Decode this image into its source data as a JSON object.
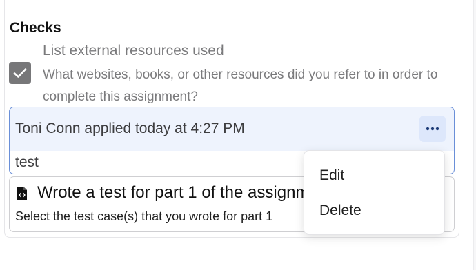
{
  "checks": {
    "section_title": "Checks",
    "item": {
      "checked": true,
      "title": "List external resources used",
      "description": "What websites, books, or other resources did you refer to in order to complete this assignment?"
    }
  },
  "comment": {
    "author_line": "Toni Conn applied today at 4:27 PM",
    "more_icon": "ellipsis-horizontal-icon",
    "body": "test"
  },
  "task": {
    "icon": "code-file-icon",
    "title": "Wrote a test for part 1 of the assignment",
    "description": "Select the test case(s) that you wrote for part 1"
  },
  "context_menu": {
    "items": [
      "Edit",
      "Delete"
    ]
  },
  "colors": {
    "accent": "#6a8fd8",
    "comment_bg": "#eef3fd",
    "checkbox_bg": "#777779",
    "muted_text": "#7a7a7c"
  }
}
